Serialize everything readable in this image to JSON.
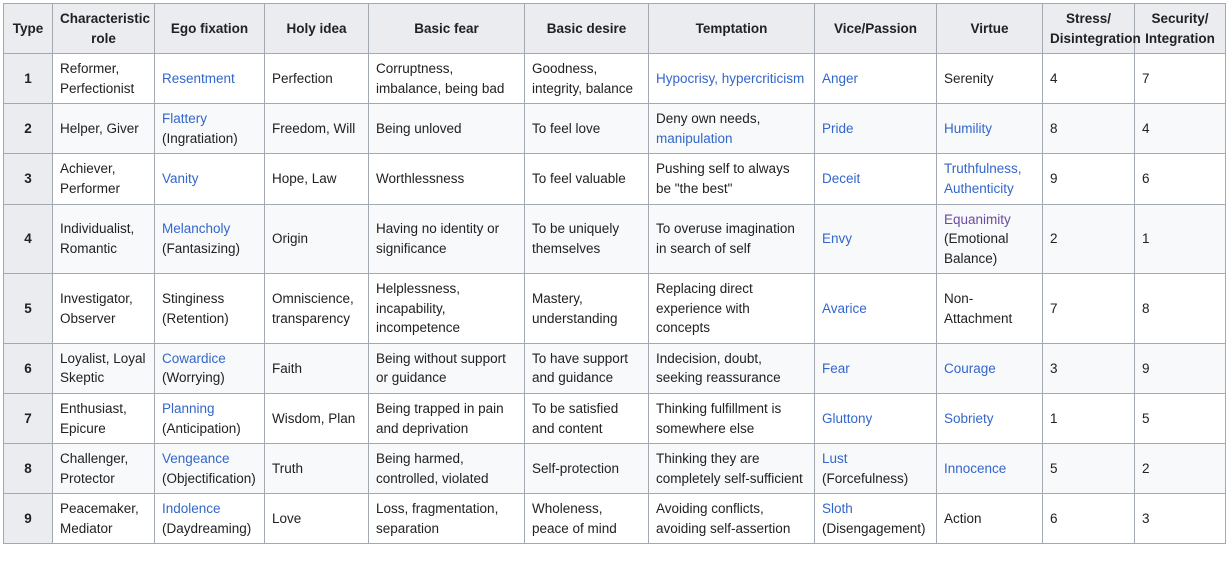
{
  "table": {
    "columns": [
      {
        "key": "type",
        "label": "Type"
      },
      {
        "key": "role",
        "label": "Characteristic role"
      },
      {
        "key": "ego",
        "label": "Ego fixation"
      },
      {
        "key": "holy",
        "label": "Holy idea"
      },
      {
        "key": "fear",
        "label": "Basic fear"
      },
      {
        "key": "desire",
        "label": "Basic desire"
      },
      {
        "key": "temptation",
        "label": "Temptation"
      },
      {
        "key": "vice",
        "label": "Vice/Passion"
      },
      {
        "key": "virtue",
        "label": "Virtue"
      },
      {
        "key": "stress",
        "label": "Stress/ Disintegration"
      },
      {
        "key": "security",
        "label": "Security/ Integration"
      }
    ],
    "header_two_line": {
      "role_l1": "Characteristic",
      "role_l2": "role",
      "stress_l1": "Stress/",
      "stress_l2": "Disintegration",
      "security_l1": "Security/",
      "security_l2": "Integration"
    },
    "rows": [
      {
        "type": "1",
        "role": "Reformer, Perfectionist",
        "ego": "Resentment",
        "ego_link": true,
        "ego_paren": "",
        "holy": "Perfection",
        "fear": "Corruptness, imbalance, being bad",
        "desire": "Goodness, integrity, balance",
        "temptation": "Hypocrisy, hypercriticism",
        "temptation_link": true,
        "vice": "Anger",
        "vice_link": true,
        "virtue": "Serenity",
        "virtue_link": false,
        "virtue_paren": "",
        "stress": "4",
        "security": "7"
      },
      {
        "type": "2",
        "role": "Helper, Giver",
        "ego": "Flattery",
        "ego_link": true,
        "ego_paren": "(Ingratiation)",
        "holy": "Freedom, Will",
        "fear": "Being unloved",
        "desire": "To feel love",
        "temptation": "Deny own needs, manipulation",
        "temptation_link": false,
        "temptation_partial_link": "manipulation",
        "vice": "Pride",
        "vice_link": true,
        "virtue": "Humility",
        "virtue_link": true,
        "virtue_paren": "",
        "stress": "8",
        "security": "4"
      },
      {
        "type": "3",
        "role": "Achiever, Performer",
        "ego": "Vanity",
        "ego_link": true,
        "ego_paren": "",
        "holy": "Hope, Law",
        "fear": "Worthlessness",
        "desire": "To feel valuable",
        "temptation": "Pushing self to always be \"the best\"",
        "temptation_link": false,
        "vice": "Deceit",
        "vice_link": true,
        "virtue": "Truthfulness, Authenticity",
        "virtue_link": true,
        "virtue_paren": "",
        "stress": "9",
        "security": "6"
      },
      {
        "type": "4",
        "role": "Individualist, Romantic",
        "ego": "Melancholy",
        "ego_link": true,
        "ego_paren": "(Fantasizing)",
        "holy": "Origin",
        "fear": "Having no identity or significance",
        "desire": "To be uniquely themselves",
        "temptation": "To overuse imagination in search of self",
        "temptation_link": false,
        "vice": "Envy",
        "vice_link": true,
        "virtue": "Equanimity",
        "virtue_link": true,
        "virtue_visited": true,
        "virtue_paren": "(Emotional Balance)",
        "stress": "2",
        "security": "1"
      },
      {
        "type": "5",
        "role": "Investigator, Observer",
        "ego": "Stinginess",
        "ego_link": false,
        "ego_paren": "(Retention)",
        "holy": "Omniscience, transparency",
        "fear": "Helplessness, incapability, incompetence",
        "desire": "Mastery, understanding",
        "temptation": "Replacing direct experience with concepts",
        "temptation_link": false,
        "vice": "Avarice",
        "vice_link": true,
        "virtue": "Non-Attachment",
        "virtue_link": false,
        "virtue_paren": "",
        "stress": "7",
        "security": "8"
      },
      {
        "type": "6",
        "role": "Loyalist, Loyal Skeptic",
        "ego": "Cowardice",
        "ego_link": true,
        "ego_paren": "(Worrying)",
        "holy": "Faith",
        "fear": "Being without support or guidance",
        "desire": "To have support and guidance",
        "temptation": "Indecision, doubt, seeking reassurance",
        "temptation_link": false,
        "vice": "Fear",
        "vice_link": true,
        "virtue": "Courage",
        "virtue_link": true,
        "virtue_paren": "",
        "stress": "3",
        "security": "9"
      },
      {
        "type": "7",
        "role": "Enthusiast, Epicure",
        "ego": "Planning",
        "ego_link": true,
        "ego_paren": "(Anticipation)",
        "holy": "Wisdom, Plan",
        "fear": "Being trapped in pain and deprivation",
        "desire": "To be satisfied and content",
        "temptation": "Thinking fulfillment is somewhere else",
        "temptation_link": false,
        "vice": "Gluttony",
        "vice_link": true,
        "virtue": "Sobriety",
        "virtue_link": true,
        "virtue_paren": "",
        "stress": "1",
        "security": "5"
      },
      {
        "type": "8",
        "role": "Challenger, Protector",
        "ego": "Vengeance",
        "ego_link": true,
        "ego_paren": "(Objectification)",
        "holy": "Truth",
        "fear": "Being harmed, controlled, violated",
        "desire": "Self-protection",
        "temptation": "Thinking they are completely self-sufficient",
        "temptation_link": false,
        "vice": "Lust",
        "vice_link": true,
        "vice_paren": "(Forcefulness)",
        "virtue": "Innocence",
        "virtue_link": true,
        "virtue_paren": "",
        "stress": "5",
        "security": "2"
      },
      {
        "type": "9",
        "role": "Peacemaker, Mediator",
        "ego": "Indolence",
        "ego_link": true,
        "ego_paren": "(Daydreaming)",
        "holy": "Love",
        "fear": "Loss, fragmentation, separation",
        "desire": "Wholeness, peace of mind",
        "temptation": "Avoiding conflicts, avoiding self-assertion",
        "temptation_link": false,
        "vice": "Sloth",
        "vice_link": true,
        "vice_paren": "(Disengagement)",
        "virtue": "Action",
        "virtue_link": false,
        "virtue_paren": "",
        "stress": "6",
        "security": "3"
      }
    ]
  },
  "colors": {
    "link": "#3366cc",
    "link_visited": "#6b4ba1",
    "header_bg": "#eaecf0",
    "border": "#a2a9b1",
    "row_alt_bg": "#f8f9fa",
    "text": "#202122"
  }
}
